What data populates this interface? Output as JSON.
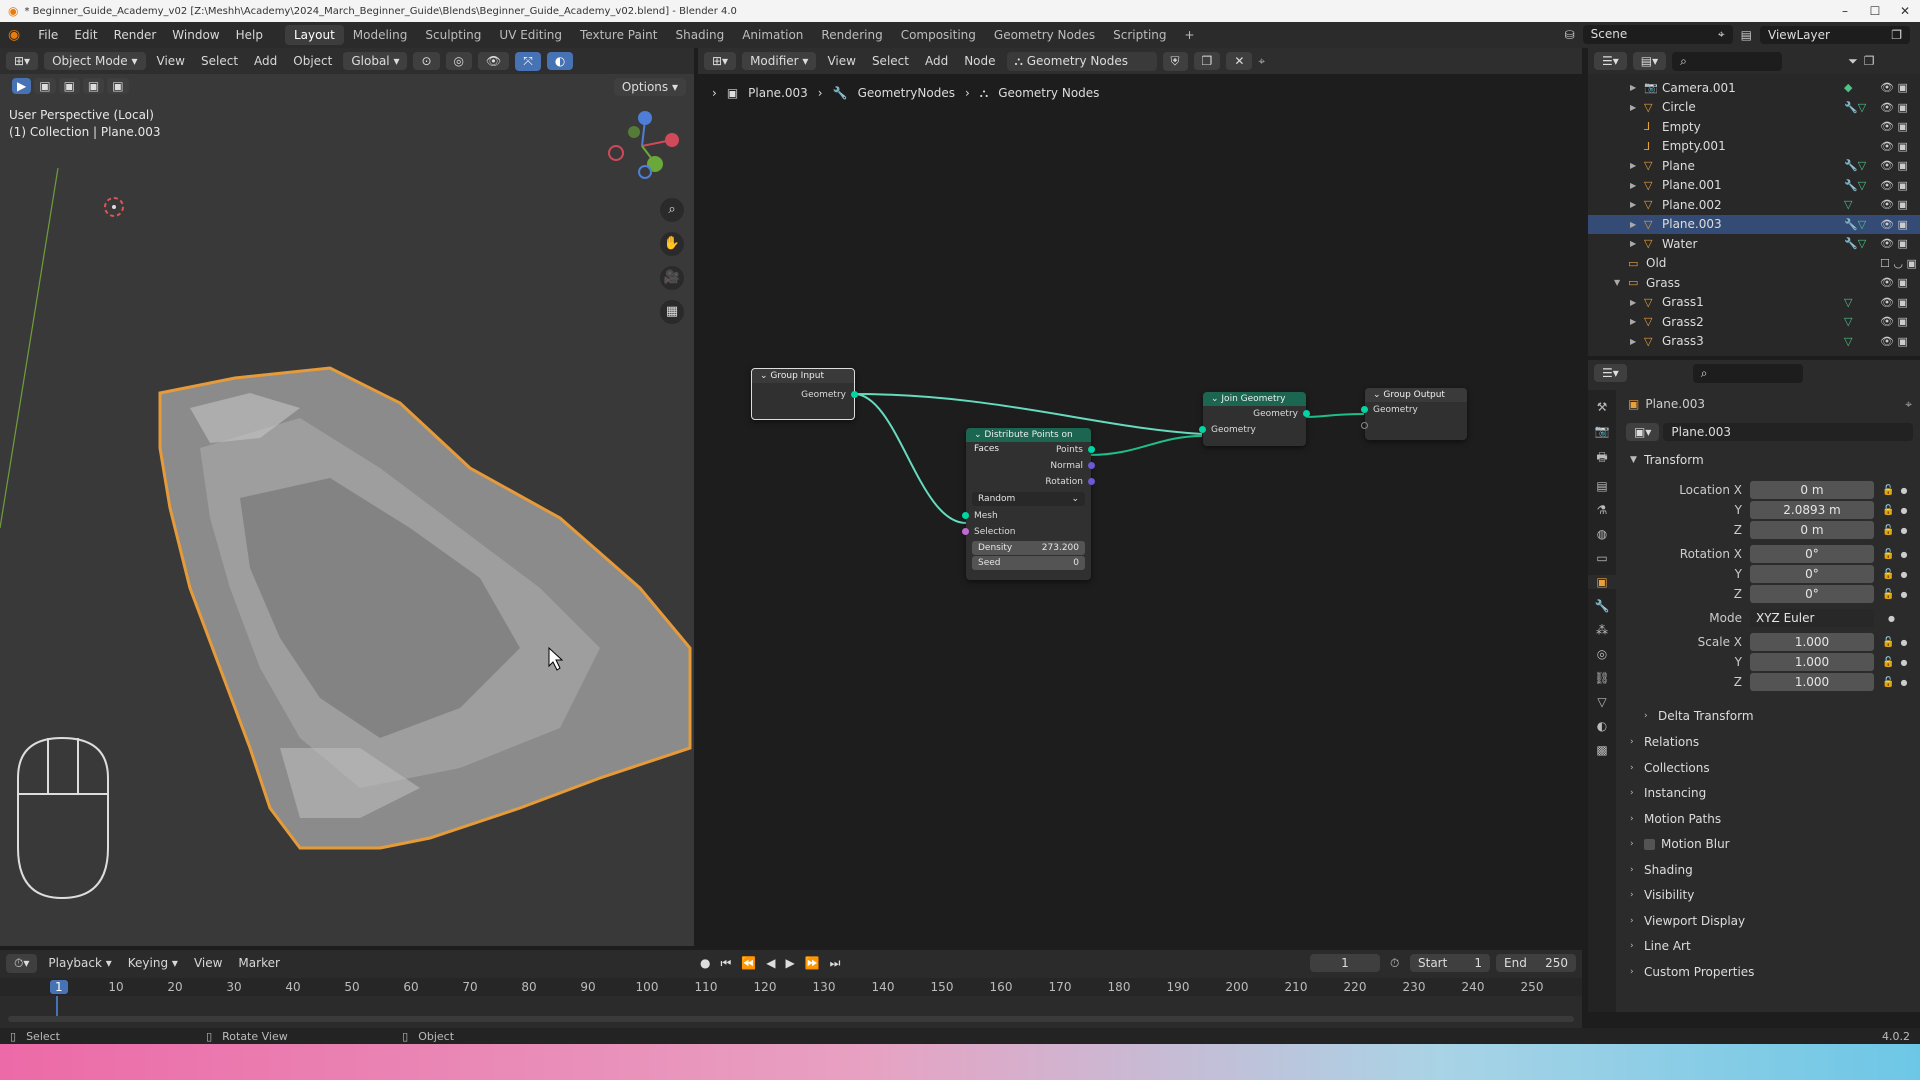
{
  "window": {
    "title": "* Beginner_Guide_Academy_v02 [Z:\\Meshh\\Academy\\2024_March_Beginner_Guide\\Blends\\Beginner_Guide_Academy_v02.blend] - Blender 4.0",
    "min": "–",
    "max": "☐",
    "close": "✕"
  },
  "topbar": {
    "menus": [
      "File",
      "Edit",
      "Render",
      "Window",
      "Help"
    ],
    "workspaces": [
      "Layout",
      "Modeling",
      "Sculpting",
      "UV Editing",
      "Texture Paint",
      "Shading",
      "Animation",
      "Rendering",
      "Compositing",
      "Geometry Nodes",
      "Scripting"
    ],
    "active_workspace": "Layout",
    "add": "+",
    "scene": "Scene",
    "view_layer": "ViewLayer"
  },
  "viewport": {
    "mode": "Object Mode",
    "menus": [
      "View",
      "Select",
      "Add",
      "Object"
    ],
    "orientation": "Global",
    "options": "Options",
    "overlay_line1": "User Perspective (Local)",
    "overlay_line2": "(1) Collection | Plane.003"
  },
  "node_editor": {
    "editor_type": "Modifier",
    "menus": [
      "View",
      "Select",
      "Add",
      "Node"
    ],
    "tree_name": "Geometry Nodes",
    "breadcrumb": [
      "Plane.003",
      "GeometryNodes",
      "Geometry Nodes"
    ],
    "nodes": {
      "group_input": {
        "title": "Group Input",
        "out": "Geometry"
      },
      "distribute": {
        "title": "Distribute Points on Faces",
        "outputs": [
          "Points",
          "Normal",
          "Rotation"
        ],
        "method": "Random",
        "inputs": [
          "Mesh",
          "Selection"
        ],
        "density_label": "Density",
        "density_value": "273.200",
        "seed_label": "Seed",
        "seed_value": "0"
      },
      "join": {
        "title": "Join Geometry",
        "out": "Geometry",
        "in": "Geometry"
      },
      "group_output": {
        "title": "Group Output",
        "in": "Geometry"
      }
    }
  },
  "outliner": {
    "items": [
      {
        "name": "Camera.001",
        "icon": "camera-icon",
        "indent": 1,
        "selected": false,
        "extra": "◆"
      },
      {
        "name": "Circle",
        "icon": "mesh-icon",
        "indent": 1,
        "selected": false,
        "extra": "🔧▽"
      },
      {
        "name": "Empty",
        "icon": "empty-icon",
        "indent": 1,
        "selected": false,
        "extra": ""
      },
      {
        "name": "Empty.001",
        "icon": "empty-icon",
        "indent": 1,
        "selected": false,
        "extra": ""
      },
      {
        "name": "Plane",
        "icon": "mesh-icon",
        "indent": 1,
        "selected": false,
        "extra": "🔧▽"
      },
      {
        "name": "Plane.001",
        "icon": "mesh-icon",
        "indent": 1,
        "selected": false,
        "extra": "🔧▽"
      },
      {
        "name": "Plane.002",
        "icon": "mesh-icon",
        "indent": 1,
        "selected": false,
        "extra": "▽"
      },
      {
        "name": "Plane.003",
        "icon": "mesh-icon",
        "indent": 1,
        "selected": true,
        "extra": "🔧▽"
      },
      {
        "name": "Water",
        "icon": "mesh-icon",
        "indent": 1,
        "selected": false,
        "extra": "🔧▽"
      },
      {
        "name": "Old",
        "icon": "collection-icon",
        "indent": 0,
        "selected": false,
        "extra": ""
      },
      {
        "name": "Grass",
        "icon": "collection-icon",
        "indent": 0,
        "selected": false,
        "extra": ""
      },
      {
        "name": "Grass1",
        "icon": "mesh-icon",
        "indent": 1,
        "selected": false,
        "extra": "▽"
      },
      {
        "name": "Grass2",
        "icon": "mesh-icon",
        "indent": 1,
        "selected": false,
        "extra": "▽"
      },
      {
        "name": "Grass3",
        "icon": "mesh-icon",
        "indent": 1,
        "selected": false,
        "extra": "▽"
      }
    ]
  },
  "properties": {
    "object_name": "Plane.003",
    "object_data_name": "Plane.003",
    "transform_label": "Transform",
    "rows": [
      {
        "label": "Location X",
        "value": "0 m"
      },
      {
        "label": "Y",
        "value": "2.0893 m"
      },
      {
        "label": "Z",
        "value": "0 m"
      },
      {
        "label": "Rotation X",
        "value": "0°"
      },
      {
        "label": "Y",
        "value": "0°"
      },
      {
        "label": "Z",
        "value": "0°"
      },
      {
        "label": "Mode",
        "value": "XYZ Euler"
      },
      {
        "label": "Scale X",
        "value": "1.000"
      },
      {
        "label": "Y",
        "value": "1.000"
      },
      {
        "label": "Z",
        "value": "1.000"
      }
    ],
    "delta": "Delta Transform",
    "sections": [
      "Relations",
      "Collections",
      "Instancing",
      "Motion Paths",
      "Motion Blur",
      "Shading",
      "Visibility",
      "Viewport Display",
      "Line Art",
      "Custom Properties"
    ]
  },
  "timeline": {
    "menus": [
      "Playback",
      "Keying",
      "View",
      "Marker"
    ],
    "current_frame": "1",
    "start_label": "Start",
    "start": "1",
    "end_label": "End",
    "end": "250",
    "ticks": [
      "1",
      "10",
      "20",
      "30",
      "40",
      "50",
      "60",
      "70",
      "80",
      "90",
      "100",
      "110",
      "120",
      "130",
      "140",
      "150",
      "160",
      "170",
      "180",
      "190",
      "200",
      "210",
      "220",
      "230",
      "240",
      "250"
    ]
  },
  "statusbar": {
    "select": "Select",
    "rotate": "Rotate View",
    "object": "Object",
    "version": "4.0.2"
  }
}
